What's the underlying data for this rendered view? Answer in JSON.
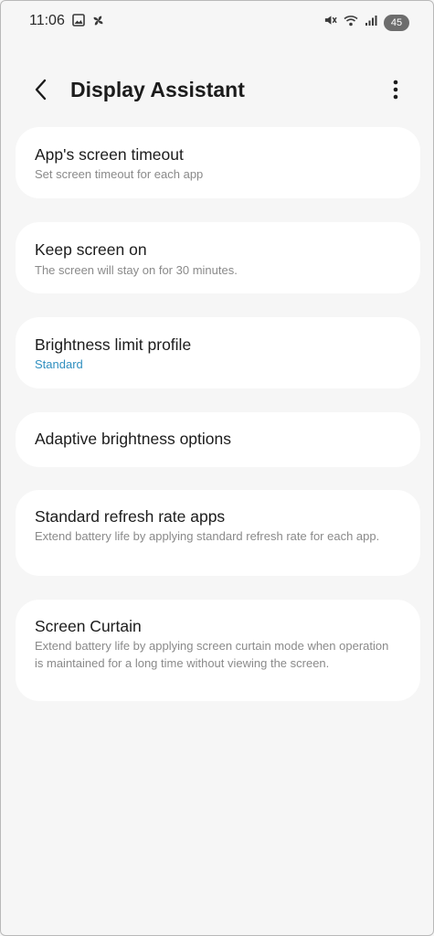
{
  "status_bar": {
    "time": "11:06",
    "left_icons": [
      "image-icon",
      "pinwheel-icon"
    ],
    "right_icons": [
      "mute-icon",
      "wifi-icon",
      "signal-icon"
    ],
    "battery": "45"
  },
  "header": {
    "title": "Display Assistant",
    "back_icon": "chevron-left-icon",
    "more_icon": "more-vertical-icon"
  },
  "items": [
    {
      "title": "App's screen timeout",
      "subtitle": "Set screen timeout for each app"
    },
    {
      "title": "Keep screen on",
      "subtitle": "The screen will stay on for 30 minutes."
    },
    {
      "title": "Brightness limit profile",
      "subtitle": "Standard"
    },
    {
      "title": "Adaptive brightness options"
    },
    {
      "title": "Standard refresh rate apps",
      "subtitle": "Extend battery life by applying standard refresh rate for each app."
    },
    {
      "title": "Screen Curtain",
      "subtitle": "Extend battery life by applying screen curtain mode when operation is maintained for a long time without viewing the screen."
    }
  ],
  "colors": {
    "background": "#f6f6f6",
    "card": "#ffffff",
    "accent_subtitle": "#2f8fbf",
    "secondary_text": "#8a8a8a"
  }
}
